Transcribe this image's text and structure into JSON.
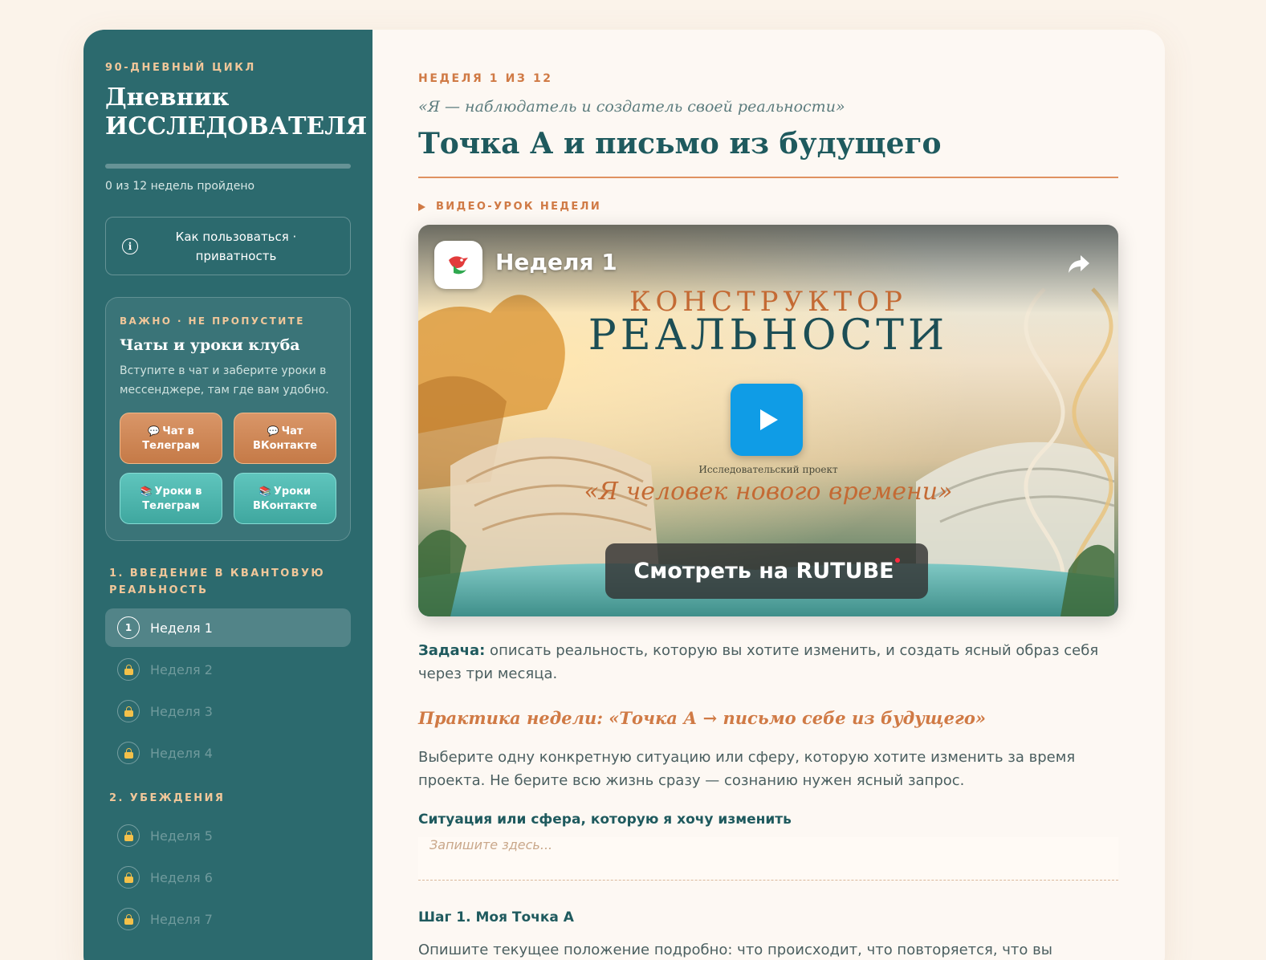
{
  "sidebar": {
    "eyebrow": "90-ДНЕВНЫЙ ЦИКЛ",
    "title": "Дневник ИССЛЕДОВАТЕЛЯ",
    "progress": {
      "completed": 0,
      "total": 12,
      "text": "0 из 12 недель пройдено"
    },
    "help_label": "Как пользоваться · приватность",
    "important": {
      "eyebrow": "ВАЖНО · НЕ ПРОПУСТИТЕ",
      "title": "Чаты и уроки клуба",
      "text": "Вступите в чат и заберите уроки в мессенджере, там где вам удобно.",
      "buttons": [
        {
          "icon": "💬",
          "label": "Чат в Телеграм",
          "style": "orange"
        },
        {
          "icon": "💬",
          "label": "Чат ВКонтакте",
          "style": "orange"
        },
        {
          "icon": "📚",
          "label": "Уроки в Телеграм",
          "style": "teal"
        },
        {
          "icon": "📚",
          "label": "Уроки ВКонтакте",
          "style": "teal"
        }
      ]
    },
    "sections": [
      {
        "title": "1. ВВЕДЕНИЕ В КВАНТОВУЮ РЕАЛЬНОСТЬ",
        "weeks": [
          {
            "badge": "1",
            "label": "Неделя 1",
            "active": true,
            "locked": false
          },
          {
            "badge": "",
            "label": "Неделя 2",
            "active": false,
            "locked": true
          },
          {
            "badge": "",
            "label": "Неделя 3",
            "active": false,
            "locked": true
          },
          {
            "badge": "",
            "label": "Неделя 4",
            "active": false,
            "locked": true
          }
        ]
      },
      {
        "title": "2. УБЕЖДЕНИЯ",
        "weeks": [
          {
            "badge": "",
            "label": "Неделя 5",
            "active": false,
            "locked": true
          },
          {
            "badge": "",
            "label": "Неделя 6",
            "active": false,
            "locked": true
          },
          {
            "badge": "",
            "label": "Неделя 7",
            "active": false,
            "locked": true
          }
        ]
      }
    ]
  },
  "main": {
    "eyebrow": "НЕДЕЛЯ 1 ИЗ 12",
    "subtitle": "«Я — наблюдатель и создатель своей реальности»",
    "title": "Точка А и письмо из будущего",
    "video_label": "ВИДЕО-УРОК НЕДЕЛИ",
    "video": {
      "title": "Неделя 1",
      "poster_line1": "КОНСТРУКТОР",
      "poster_line2": "РЕАЛЬНОСТИ",
      "poster_small": "Исследовательский проект",
      "poster_quote": "«Я человек нового времени»",
      "watch_label": "Смотреть на RUTUBE"
    },
    "task_label": "Задача:",
    "task_text": " описать реальность, которую вы хотите изменить, и создать ясный образ себя через три месяца.",
    "practice_title": "Практика недели: «Точка А → письмо себе из будущего»",
    "practice_text": "Выберите одну конкретную ситуацию или сферу, которую хотите изменить за время проекта. Не берите всю жизнь сразу — сознанию нужен ясный запрос.",
    "field_label": "Ситуация или сфера, которую я хочу изменить",
    "field_placeholder": "Запишите здесь...",
    "field_value": "",
    "step_title": "Шаг 1. Моя Точка А",
    "step_text": "Опишите текущее положение подробно: что происходит, что повторяется, что вы думаете и"
  },
  "colors": {
    "sidebar_bg": "#2c6a6e",
    "accent_orange": "#d07a45",
    "accent_teal": "#3fa79f",
    "title_teal": "#1f5a5e",
    "page_bg": "#fbf3ea"
  }
}
